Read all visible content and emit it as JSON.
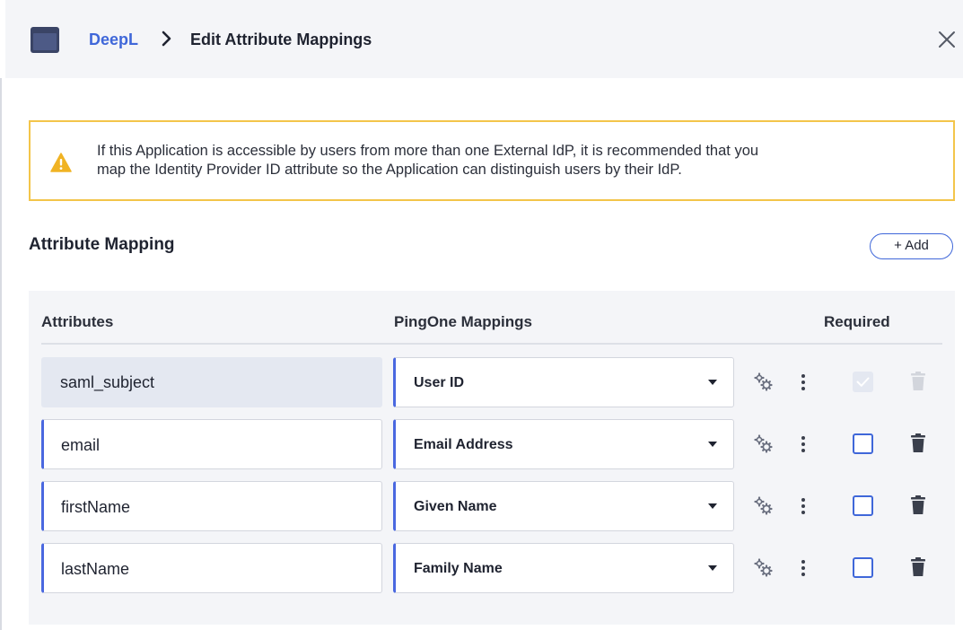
{
  "header": {
    "app_name": "DeepL",
    "page_title": "Edit Attribute Mappings",
    "close_label": "close"
  },
  "warning": {
    "icon": "warning-icon",
    "line1": "If this Application is accessible by users from more than one External IdP, it is recommended that you",
    "line2": "map the Identity Provider ID attribute so the Application can distinguish users by their IdP."
  },
  "section": {
    "title": "Attribute Mapping",
    "add_label": "+ Add"
  },
  "table": {
    "headers": {
      "attributes": "Attributes",
      "mappings": "PingOne Mappings",
      "required": "Required"
    },
    "rows": [
      {
        "attribute": "saml_subject",
        "mapping": "User ID",
        "required": true,
        "editable": false
      },
      {
        "attribute": "email",
        "mapping": "Email Address",
        "required": false,
        "editable": true
      },
      {
        "attribute": "firstName",
        "mapping": "Given Name",
        "required": false,
        "editable": true
      },
      {
        "attribute": "lastName",
        "mapping": "Family Name",
        "required": false,
        "editable": true
      }
    ]
  },
  "colors": {
    "accent": "#3f67d9",
    "warning_border": "#f3c54a",
    "panel_bg": "#f4f5f8"
  }
}
